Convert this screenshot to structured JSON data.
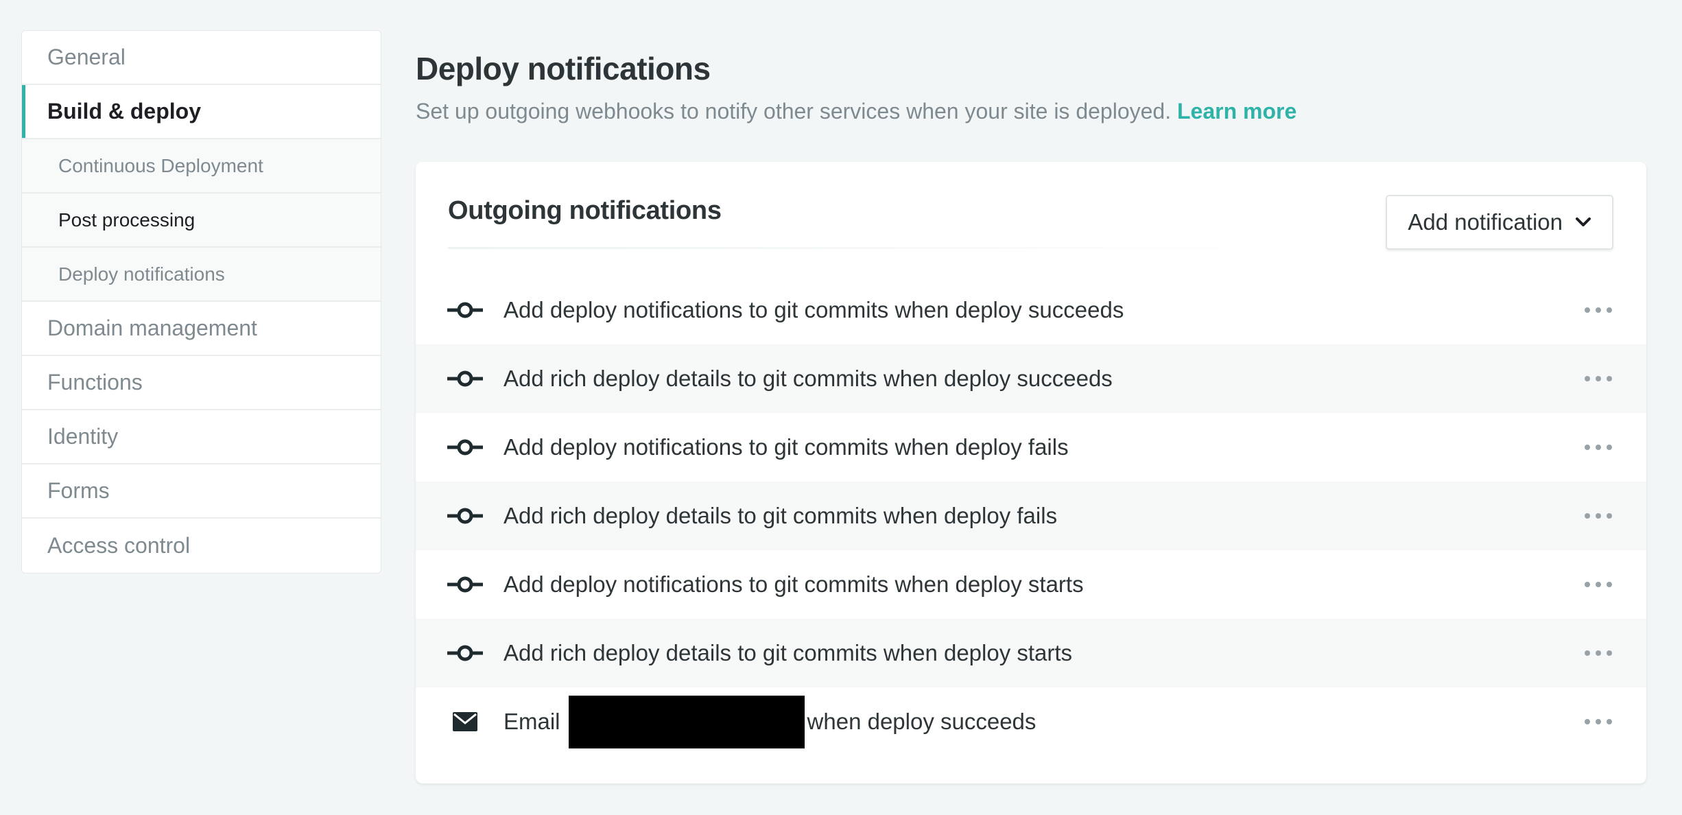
{
  "sidebar": {
    "items": [
      {
        "label": "General"
      },
      {
        "label": "Build & deploy"
      },
      {
        "label": "Continuous Deployment"
      },
      {
        "label": "Post processing"
      },
      {
        "label": "Deploy notifications"
      },
      {
        "label": "Domain management"
      },
      {
        "label": "Functions"
      },
      {
        "label": "Identity"
      },
      {
        "label": "Forms"
      },
      {
        "label": "Access control"
      }
    ]
  },
  "main": {
    "title": "Deploy notifications",
    "description": "Set up outgoing webhooks to notify other services when your site is deployed.",
    "learn_more": "Learn more"
  },
  "card": {
    "title": "Outgoing notifications",
    "add_button": "Add notification",
    "notifications": [
      {
        "icon": "git-commit-icon",
        "text": "Add deploy notifications to git commits when deploy succeeds"
      },
      {
        "icon": "git-commit-icon",
        "text": "Add rich deploy details to git commits when deploy succeeds"
      },
      {
        "icon": "git-commit-icon",
        "text": "Add deploy notifications to git commits when deploy fails"
      },
      {
        "icon": "git-commit-icon",
        "text": "Add rich deploy details to git commits when deploy fails"
      },
      {
        "icon": "git-commit-icon",
        "text": "Add deploy notifications to git commits when deploy starts"
      },
      {
        "icon": "git-commit-icon",
        "text": "Add rich deploy details to git commits when deploy starts"
      },
      {
        "icon": "envelope-icon",
        "text_before": "Email",
        "text_after": "when deploy succeeds"
      }
    ]
  },
  "colors": {
    "accent": "#2fb3a8",
    "background": "#f2f6f6",
    "text_dark": "#2d3538",
    "text_muted": "#7f8a90"
  }
}
